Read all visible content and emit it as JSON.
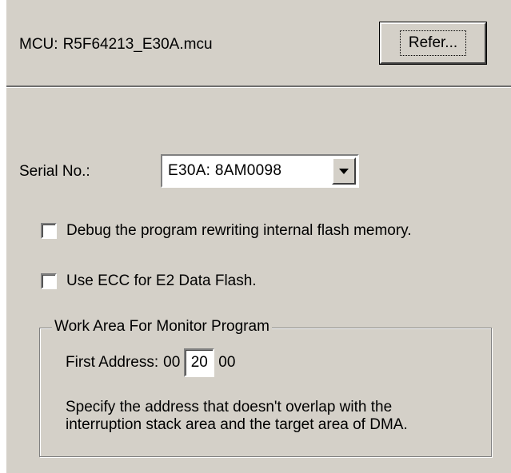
{
  "mcu": {
    "label": "MCU:",
    "file": "R5F64213_E30A.mcu",
    "refer_button": "Refer..."
  },
  "serial": {
    "label": "Serial No.:",
    "selected": "E30A: 8AM0098"
  },
  "options": {
    "debug_flash": {
      "label": "Debug the program rewriting internal flash memory.",
      "checked": false
    },
    "use_ecc": {
      "label": "Use ECC for E2 Data Flash.",
      "checked": false
    }
  },
  "work_area": {
    "title": "Work Area For Monitor Program",
    "first_address_label": "First Address:",
    "addr_prefix": "00",
    "addr_value": "20",
    "addr_suffix": "00",
    "note_line1": "Specify the address that doesn't overlap with the",
    "note_line2": "interruption stack area and the target area of DMA."
  }
}
